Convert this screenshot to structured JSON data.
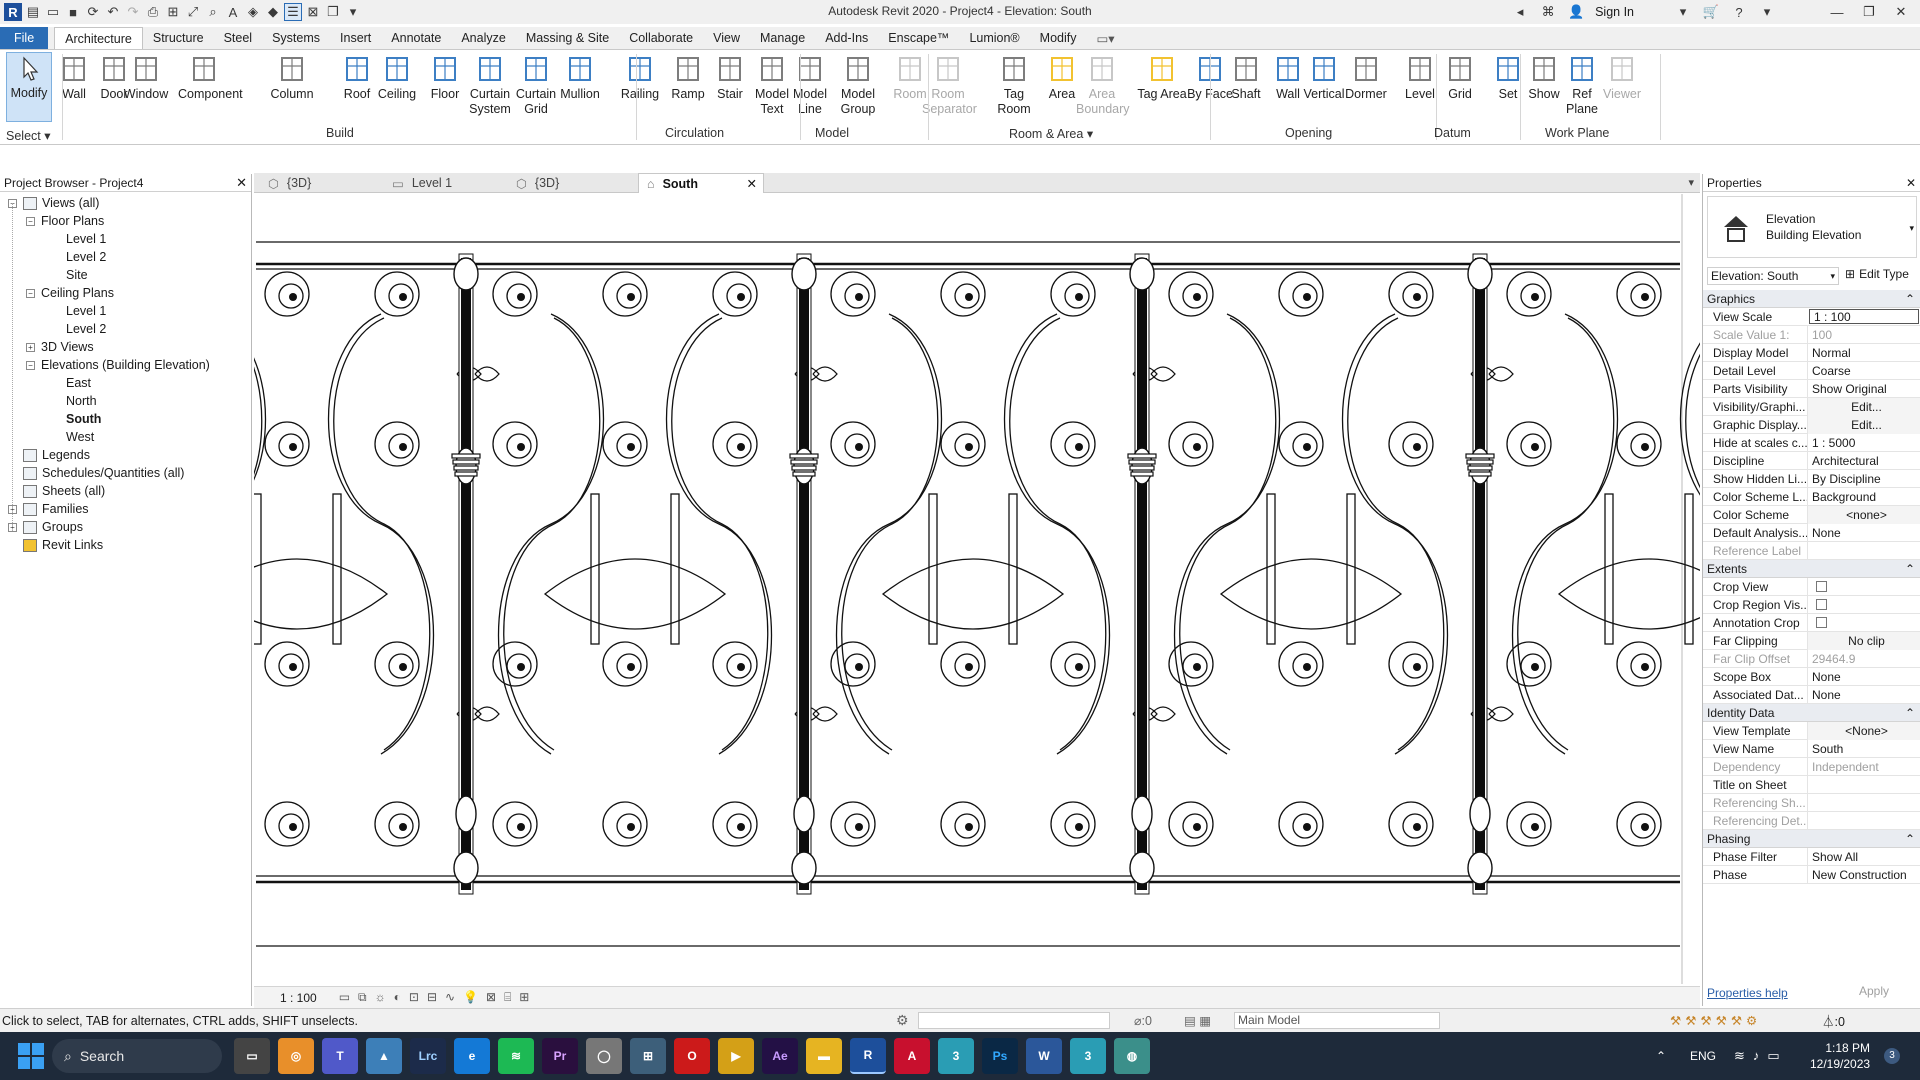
{
  "window": {
    "title": "Autodesk Revit 2020 - Project4 - Elevation: South",
    "sign_in": "Sign In"
  },
  "ribbon_tabs": [
    "File",
    "Architecture",
    "Structure",
    "Steel",
    "Systems",
    "Insert",
    "Annotate",
    "Analyze",
    "Massing & Site",
    "Collaborate",
    "View",
    "Manage",
    "Add-Ins",
    "Enscape™",
    "Lumion®",
    "Modify"
  ],
  "ribbon": {
    "select_label": "Select",
    "modify": "Modify",
    "build": {
      "label": "Build",
      "items": [
        "Wall",
        "Door",
        "Window",
        "Component",
        "Column",
        "Roof",
        "Ceiling",
        "Floor",
        "Curtain System",
        "Curtain Grid",
        "Mullion"
      ]
    },
    "circulation": {
      "label": "Circulation",
      "items": [
        "Railing",
        "Ramp",
        "Stair"
      ]
    },
    "model": {
      "label": "Model",
      "items": [
        "Model Text",
        "Model Line",
        "Model Group"
      ]
    },
    "room_area": {
      "label": "Room & Area",
      "items": [
        "Room",
        "Room Separator",
        "Tag Room",
        "Area",
        "Area Boundary",
        "Tag Area"
      ]
    },
    "opening": {
      "label": "Opening",
      "items": [
        "By Face",
        "Shaft",
        "Wall",
        "Vertical",
        "Dormer"
      ]
    },
    "datum": {
      "label": "Datum",
      "items": [
        "Level",
        "Grid"
      ]
    },
    "work_plane": {
      "label": "Work Plane",
      "items": [
        "Set",
        "Show",
        "Ref Plane",
        "Viewer"
      ]
    }
  },
  "project_browser": {
    "title": "Project Browser - Project4",
    "rows": [
      {
        "text": "Views (all)",
        "expander": "−",
        "icon": "views"
      },
      {
        "text": "Floor Plans",
        "expander": "−"
      },
      {
        "text": "Level 1"
      },
      {
        "text": "Level 2"
      },
      {
        "text": "Site"
      },
      {
        "text": "Ceiling Plans",
        "expander": "−"
      },
      {
        "text": "Level 1"
      },
      {
        "text": "Level 2"
      },
      {
        "text": "3D Views",
        "expander": "+"
      },
      {
        "text": "Elevations (Building Elevation)",
        "expander": "−"
      },
      {
        "text": "East"
      },
      {
        "text": "North"
      },
      {
        "text": "South",
        "selected": true
      },
      {
        "text": "West"
      },
      {
        "text": "Legends",
        "icon": "legend"
      },
      {
        "text": "Schedules/Quantities (all)",
        "icon": "schedule"
      },
      {
        "text": "Sheets (all)",
        "icon": "sheet"
      },
      {
        "text": "Families",
        "expander": "+",
        "icon": "family"
      },
      {
        "text": "Groups",
        "expander": "+",
        "icon": "group"
      },
      {
        "text": "Revit Links",
        "icon": "link"
      }
    ]
  },
  "view_tabs": [
    {
      "label": "{3D}",
      "icon": "3d"
    },
    {
      "label": "Level 1",
      "icon": "plan"
    },
    {
      "label": "{3D}",
      "icon": "3d"
    },
    {
      "label": "South",
      "icon": "elevation",
      "active": true
    }
  ],
  "view_control_bar": {
    "scale": "1 : 100"
  },
  "properties": {
    "title": "Properties",
    "type_line1": "Elevation",
    "type_line2": "Building Elevation",
    "selector": "Elevation: South",
    "edit_type": "Edit Type",
    "groups": [
      {
        "name": "Graphics",
        "rows": [
          {
            "k": "View Scale",
            "v": "1 : 100",
            "box": true
          },
          {
            "k": "Scale Value    1:",
            "v": "100",
            "dim": true
          },
          {
            "k": "Display Model",
            "v": "Normal"
          },
          {
            "k": "Detail Level",
            "v": "Coarse"
          },
          {
            "k": "Parts Visibility",
            "v": "Show Original"
          },
          {
            "k": "Visibility/Graphi...",
            "v": "Edit...",
            "button": true
          },
          {
            "k": "Graphic Display...",
            "v": "Edit...",
            "button": true
          },
          {
            "k": "Hide at scales c...",
            "v": "1 : 5000"
          },
          {
            "k": "Discipline",
            "v": "Architectural"
          },
          {
            "k": "Show Hidden Li...",
            "v": "By Discipline"
          },
          {
            "k": "Color Scheme L...",
            "v": "Background"
          },
          {
            "k": "Color Scheme",
            "v": "<none>",
            "button": true
          },
          {
            "k": "Default Analysis...",
            "v": "None"
          },
          {
            "k": "Reference Label",
            "v": "",
            "dim": true
          }
        ]
      },
      {
        "name": "Extents",
        "rows": [
          {
            "k": "Crop View",
            "v": "",
            "check": true
          },
          {
            "k": "Crop Region Vis...",
            "v": "",
            "check": true
          },
          {
            "k": "Annotation Crop",
            "v": "",
            "check": true
          },
          {
            "k": "Far Clipping",
            "v": "No clip",
            "button": true
          },
          {
            "k": "Far Clip Offset",
            "v": "29464.9",
            "dim": true
          },
          {
            "k": "Scope Box",
            "v": "None"
          },
          {
            "k": "Associated Dat...",
            "v": "None"
          }
        ]
      },
      {
        "name": "Identity Data",
        "rows": [
          {
            "k": "View Template",
            "v": "<None>",
            "button": true
          },
          {
            "k": "View Name",
            "v": "South"
          },
          {
            "k": "Dependency",
            "v": "Independent",
            "dim": true
          },
          {
            "k": "Title on Sheet",
            "v": ""
          },
          {
            "k": "Referencing Sh...",
            "v": "",
            "dim": true
          },
          {
            "k": "Referencing Det...",
            "v": "",
            "dim": true
          }
        ]
      },
      {
        "name": "Phasing",
        "rows": [
          {
            "k": "Phase Filter",
            "v": "Show All"
          },
          {
            "k": "Phase",
            "v": "New Construction"
          }
        ]
      }
    ],
    "help_link": "Properties help",
    "apply": "Apply"
  },
  "status_bar": {
    "hint": "Click to select, TAB for alternates, CTRL adds, SHIFT unselects.",
    "zero": ":0",
    "model": "Main Model",
    "filter": ":0"
  },
  "taskbar": {
    "search": "Search",
    "apps": [
      "Lrc",
      "Pr",
      "Ae",
      "R",
      "A",
      "Ps",
      "W"
    ],
    "lang": "ENG",
    "time": "1:18 PM",
    "date": "12/19/2023",
    "notif": "3"
  },
  "colors": {
    "file_tab": "#2a6cb5",
    "taskbar": "#1e2a3a",
    "active_view_tab": "#ffffff"
  }
}
